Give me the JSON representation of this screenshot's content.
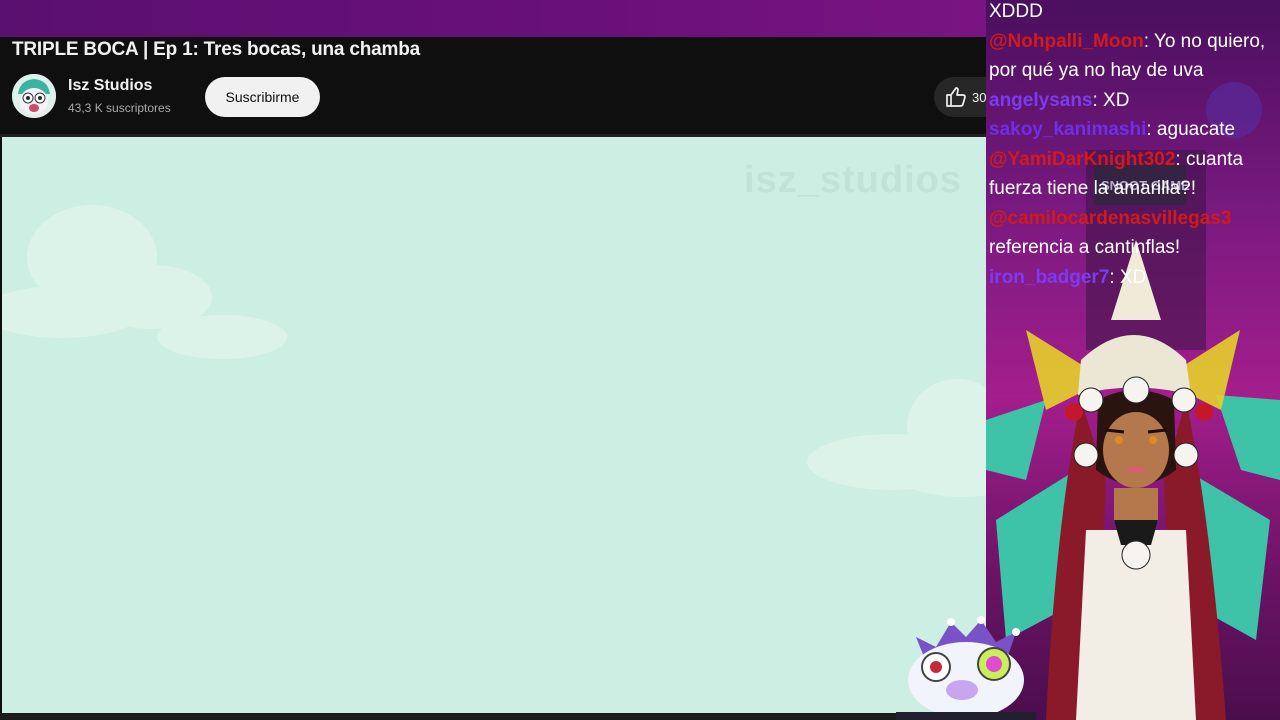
{
  "video": {
    "title": "TRIPLE BOCA | Ep 1: Tres bocas, una chamba",
    "channel_name": "Isz Studios",
    "subscribers": "43,3 K suscriptores",
    "subscribe_label": "Suscribirme",
    "like_count": "30",
    "watermark": "isz_studios"
  },
  "chat": {
    "lines": [
      {
        "user": "",
        "message": "XDDD"
      },
      {
        "user": "@Nohpalli_Moon",
        "message": ": Yo no quiero, por qué ya no hay de uva"
      },
      {
        "user": "angelysans",
        "message": ": XD"
      },
      {
        "user": "sakoy_kanimashi",
        "message": ": aguacate"
      },
      {
        "user": "@YamiDarKnight302",
        "message": ": cuanta fuerza tiene la amarilla?!"
      },
      {
        "user": "@camilocardenasvillegas3",
        "message": ""
      },
      {
        "user": "",
        "message": "referencia a cantinflas!"
      },
      {
        "user": "iron_badger7",
        "message": ": XD"
      }
    ]
  },
  "overlay": {
    "sign_text": "SNOOT GAME"
  },
  "colors": {
    "accent_purple": "#6a107a",
    "video_background": "#cdeee2",
    "chat_user_red": "#d11a1a",
    "chat_user_purple": "#7a3cf0"
  }
}
